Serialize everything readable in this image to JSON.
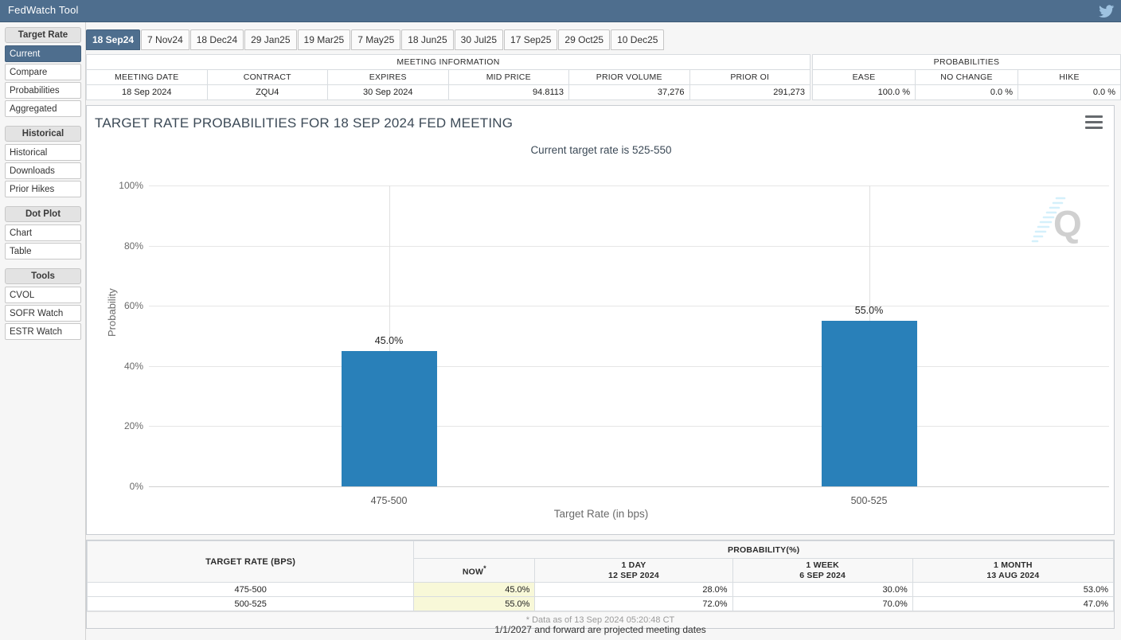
{
  "app": {
    "title": "FedWatch Tool",
    "twitter_icon": "twitter-bird-icon",
    "titlebar_color": "#4e6e8e"
  },
  "sidebar": {
    "groups": [
      {
        "heading": "Target Rate",
        "items": [
          {
            "label": "Current",
            "active": true
          },
          {
            "label": "Compare",
            "active": false
          },
          {
            "label": "Probabilities",
            "active": false
          },
          {
            "label": "Aggregated",
            "active": false
          }
        ]
      },
      {
        "heading": "Historical",
        "items": [
          {
            "label": "Historical",
            "active": false
          },
          {
            "label": "Downloads",
            "active": false
          },
          {
            "label": "Prior Hikes",
            "active": false
          }
        ]
      },
      {
        "heading": "Dot Plot",
        "items": [
          {
            "label": "Chart",
            "active": false
          },
          {
            "label": "Table",
            "active": false
          }
        ]
      },
      {
        "heading": "Tools",
        "items": [
          {
            "label": "CVOL",
            "active": false
          },
          {
            "label": "SOFR Watch",
            "active": false
          },
          {
            "label": "ESTR Watch",
            "active": false
          }
        ]
      }
    ]
  },
  "tabs": {
    "items": [
      {
        "label": "18 Sep24",
        "active": true
      },
      {
        "label": "7 Nov24",
        "active": false
      },
      {
        "label": "18 Dec24",
        "active": false
      },
      {
        "label": "29 Jan25",
        "active": false
      },
      {
        "label": "19 Mar25",
        "active": false
      },
      {
        "label": "7 May25",
        "active": false
      },
      {
        "label": "18 Jun25",
        "active": false
      },
      {
        "label": "30 Jul25",
        "active": false
      },
      {
        "label": "17 Sep25",
        "active": false
      },
      {
        "label": "29 Oct25",
        "active": false
      },
      {
        "label": "10 Dec25",
        "active": false
      }
    ]
  },
  "meeting_information": {
    "title": "MEETING INFORMATION",
    "headers": [
      "MEETING DATE",
      "CONTRACT",
      "EXPIRES",
      "MID PRICE",
      "PRIOR VOLUME",
      "PRIOR OI"
    ],
    "values": [
      "18 Sep 2024",
      "ZQU4",
      "30 Sep 2024",
      "94.8113",
      "37,276",
      "291,273"
    ]
  },
  "probabilities_summary": {
    "title": "PROBABILITIES",
    "headers": [
      "EASE",
      "NO CHANGE",
      "HIKE"
    ],
    "values": [
      "100.0 %",
      "0.0 %",
      "0.0 %"
    ]
  },
  "chart_panel": {
    "title": "TARGET RATE PROBABILITIES FOR 18 SEP 2024 FED MEETING",
    "subtitle": "Current target rate is 525-550",
    "menu_icon": "hamburger-menu-icon",
    "watermark_icon": "q-logo-watermark-icon"
  },
  "chart_data": {
    "type": "bar",
    "title": "TARGET RATE PROBABILITIES FOR 18 SEP 2024 FED MEETING",
    "subtitle": "Current target rate is 525-550",
    "categories": [
      "475-500",
      "500-525"
    ],
    "values": [
      45.0,
      55.0
    ],
    "value_labels": [
      "45.0%",
      "55.0%"
    ],
    "xlabel": "Target Rate (in bps)",
    "ylabel": "Probability",
    "ylim": [
      0,
      100
    ],
    "yticks": [
      0,
      20,
      40,
      60,
      80,
      100
    ],
    "ytick_labels": [
      "0%",
      "20%",
      "40%",
      "60%",
      "80%",
      "100%"
    ],
    "grid": true,
    "legend": false,
    "bar_color": "#2980b9"
  },
  "probability_table": {
    "col_target_rate": "TARGET RATE (BPS)",
    "group_header": "PROBABILITY(%)",
    "columns": [
      {
        "name": "NOW",
        "date": "",
        "superscript": "*"
      },
      {
        "name": "1 DAY",
        "date": "12 SEP 2024",
        "superscript": ""
      },
      {
        "name": "1 WEEK",
        "date": "6 SEP 2024",
        "superscript": ""
      },
      {
        "name": "1 MONTH",
        "date": "13 AUG 2024",
        "superscript": ""
      }
    ],
    "rows": [
      {
        "rate": "475-500",
        "now": "45.0%",
        "one_day": "28.0%",
        "one_week": "30.0%",
        "one_month": "53.0%"
      },
      {
        "rate": "500-525",
        "now": "55.0%",
        "one_day": "72.0%",
        "one_week": "70.0%",
        "one_month": "47.0%"
      }
    ],
    "footnote": "* Data as of 13 Sep 2024 05:20:48 CT"
  },
  "projection_note": "1/1/2027 and forward are projected meeting dates"
}
